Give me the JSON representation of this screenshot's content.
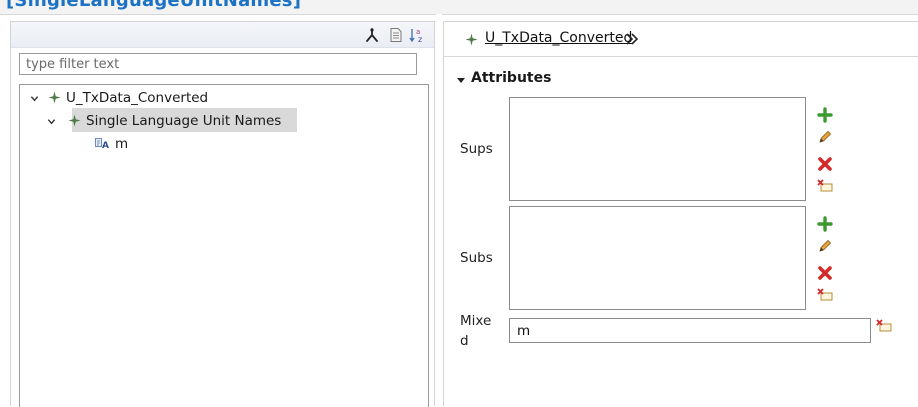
{
  "window": {
    "title": "[SingleLanguageUnitNames]"
  },
  "outline": {
    "toolbar": {
      "icons": [
        "hierarchy-icon",
        "document-icon",
        "sort-az-icon"
      ]
    },
    "filter": {
      "value": "",
      "placeholder": "type filter text"
    },
    "tree": [
      {
        "label": "U_TxData_Converted",
        "expanded": true,
        "icon": "class-icon"
      },
      {
        "label": "Single Language Unit Names",
        "expanded": true,
        "selected": true,
        "icon": "class-icon"
      },
      {
        "label": "m",
        "icon": "attribute-icon"
      }
    ]
  },
  "editor": {
    "title": "U_TxData_Converted",
    "section": {
      "title": "Attributes",
      "expanded": true
    },
    "fields": {
      "sups_label": "Sups",
      "subs_label": "Subs",
      "mixed_label_line1": "Mixe",
      "mixed_label_line2": "d",
      "mixed_value": "m"
    }
  },
  "colors": {
    "title_blue": "#1c72c4",
    "selection_gray": "#d9d9d9",
    "add_green": "#3a9a2e",
    "delete_red": "#d42a2a"
  }
}
